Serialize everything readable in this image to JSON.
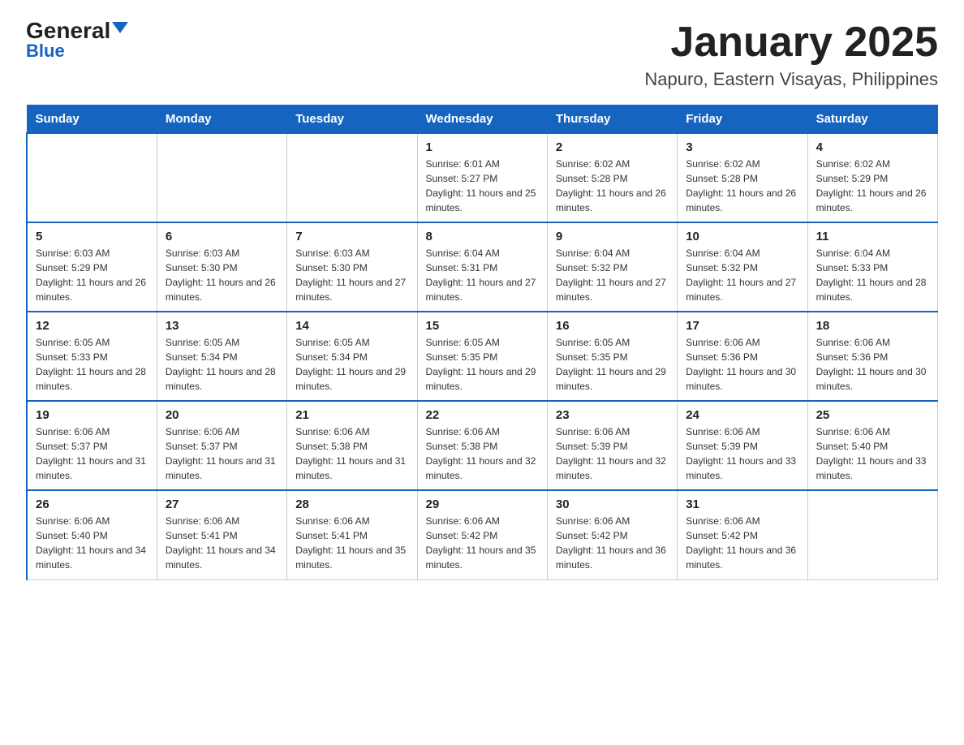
{
  "header": {
    "logo_general": "General",
    "logo_blue": "Blue",
    "month_title": "January 2025",
    "location": "Napuro, Eastern Visayas, Philippines"
  },
  "days_of_week": [
    "Sunday",
    "Monday",
    "Tuesday",
    "Wednesday",
    "Thursday",
    "Friday",
    "Saturday"
  ],
  "weeks": [
    [
      {
        "day": "",
        "info": ""
      },
      {
        "day": "",
        "info": ""
      },
      {
        "day": "",
        "info": ""
      },
      {
        "day": "1",
        "info": "Sunrise: 6:01 AM\nSunset: 5:27 PM\nDaylight: 11 hours and 25 minutes."
      },
      {
        "day": "2",
        "info": "Sunrise: 6:02 AM\nSunset: 5:28 PM\nDaylight: 11 hours and 26 minutes."
      },
      {
        "day": "3",
        "info": "Sunrise: 6:02 AM\nSunset: 5:28 PM\nDaylight: 11 hours and 26 minutes."
      },
      {
        "day": "4",
        "info": "Sunrise: 6:02 AM\nSunset: 5:29 PM\nDaylight: 11 hours and 26 minutes."
      }
    ],
    [
      {
        "day": "5",
        "info": "Sunrise: 6:03 AM\nSunset: 5:29 PM\nDaylight: 11 hours and 26 minutes."
      },
      {
        "day": "6",
        "info": "Sunrise: 6:03 AM\nSunset: 5:30 PM\nDaylight: 11 hours and 26 minutes."
      },
      {
        "day": "7",
        "info": "Sunrise: 6:03 AM\nSunset: 5:30 PM\nDaylight: 11 hours and 27 minutes."
      },
      {
        "day": "8",
        "info": "Sunrise: 6:04 AM\nSunset: 5:31 PM\nDaylight: 11 hours and 27 minutes."
      },
      {
        "day": "9",
        "info": "Sunrise: 6:04 AM\nSunset: 5:32 PM\nDaylight: 11 hours and 27 minutes."
      },
      {
        "day": "10",
        "info": "Sunrise: 6:04 AM\nSunset: 5:32 PM\nDaylight: 11 hours and 27 minutes."
      },
      {
        "day": "11",
        "info": "Sunrise: 6:04 AM\nSunset: 5:33 PM\nDaylight: 11 hours and 28 minutes."
      }
    ],
    [
      {
        "day": "12",
        "info": "Sunrise: 6:05 AM\nSunset: 5:33 PM\nDaylight: 11 hours and 28 minutes."
      },
      {
        "day": "13",
        "info": "Sunrise: 6:05 AM\nSunset: 5:34 PM\nDaylight: 11 hours and 28 minutes."
      },
      {
        "day": "14",
        "info": "Sunrise: 6:05 AM\nSunset: 5:34 PM\nDaylight: 11 hours and 29 minutes."
      },
      {
        "day": "15",
        "info": "Sunrise: 6:05 AM\nSunset: 5:35 PM\nDaylight: 11 hours and 29 minutes."
      },
      {
        "day": "16",
        "info": "Sunrise: 6:05 AM\nSunset: 5:35 PM\nDaylight: 11 hours and 29 minutes."
      },
      {
        "day": "17",
        "info": "Sunrise: 6:06 AM\nSunset: 5:36 PM\nDaylight: 11 hours and 30 minutes."
      },
      {
        "day": "18",
        "info": "Sunrise: 6:06 AM\nSunset: 5:36 PM\nDaylight: 11 hours and 30 minutes."
      }
    ],
    [
      {
        "day": "19",
        "info": "Sunrise: 6:06 AM\nSunset: 5:37 PM\nDaylight: 11 hours and 31 minutes."
      },
      {
        "day": "20",
        "info": "Sunrise: 6:06 AM\nSunset: 5:37 PM\nDaylight: 11 hours and 31 minutes."
      },
      {
        "day": "21",
        "info": "Sunrise: 6:06 AM\nSunset: 5:38 PM\nDaylight: 11 hours and 31 minutes."
      },
      {
        "day": "22",
        "info": "Sunrise: 6:06 AM\nSunset: 5:38 PM\nDaylight: 11 hours and 32 minutes."
      },
      {
        "day": "23",
        "info": "Sunrise: 6:06 AM\nSunset: 5:39 PM\nDaylight: 11 hours and 32 minutes."
      },
      {
        "day": "24",
        "info": "Sunrise: 6:06 AM\nSunset: 5:39 PM\nDaylight: 11 hours and 33 minutes."
      },
      {
        "day": "25",
        "info": "Sunrise: 6:06 AM\nSunset: 5:40 PM\nDaylight: 11 hours and 33 minutes."
      }
    ],
    [
      {
        "day": "26",
        "info": "Sunrise: 6:06 AM\nSunset: 5:40 PM\nDaylight: 11 hours and 34 minutes."
      },
      {
        "day": "27",
        "info": "Sunrise: 6:06 AM\nSunset: 5:41 PM\nDaylight: 11 hours and 34 minutes."
      },
      {
        "day": "28",
        "info": "Sunrise: 6:06 AM\nSunset: 5:41 PM\nDaylight: 11 hours and 35 minutes."
      },
      {
        "day": "29",
        "info": "Sunrise: 6:06 AM\nSunset: 5:42 PM\nDaylight: 11 hours and 35 minutes."
      },
      {
        "day": "30",
        "info": "Sunrise: 6:06 AM\nSunset: 5:42 PM\nDaylight: 11 hours and 36 minutes."
      },
      {
        "day": "31",
        "info": "Sunrise: 6:06 AM\nSunset: 5:42 PM\nDaylight: 11 hours and 36 minutes."
      },
      {
        "day": "",
        "info": ""
      }
    ]
  ]
}
